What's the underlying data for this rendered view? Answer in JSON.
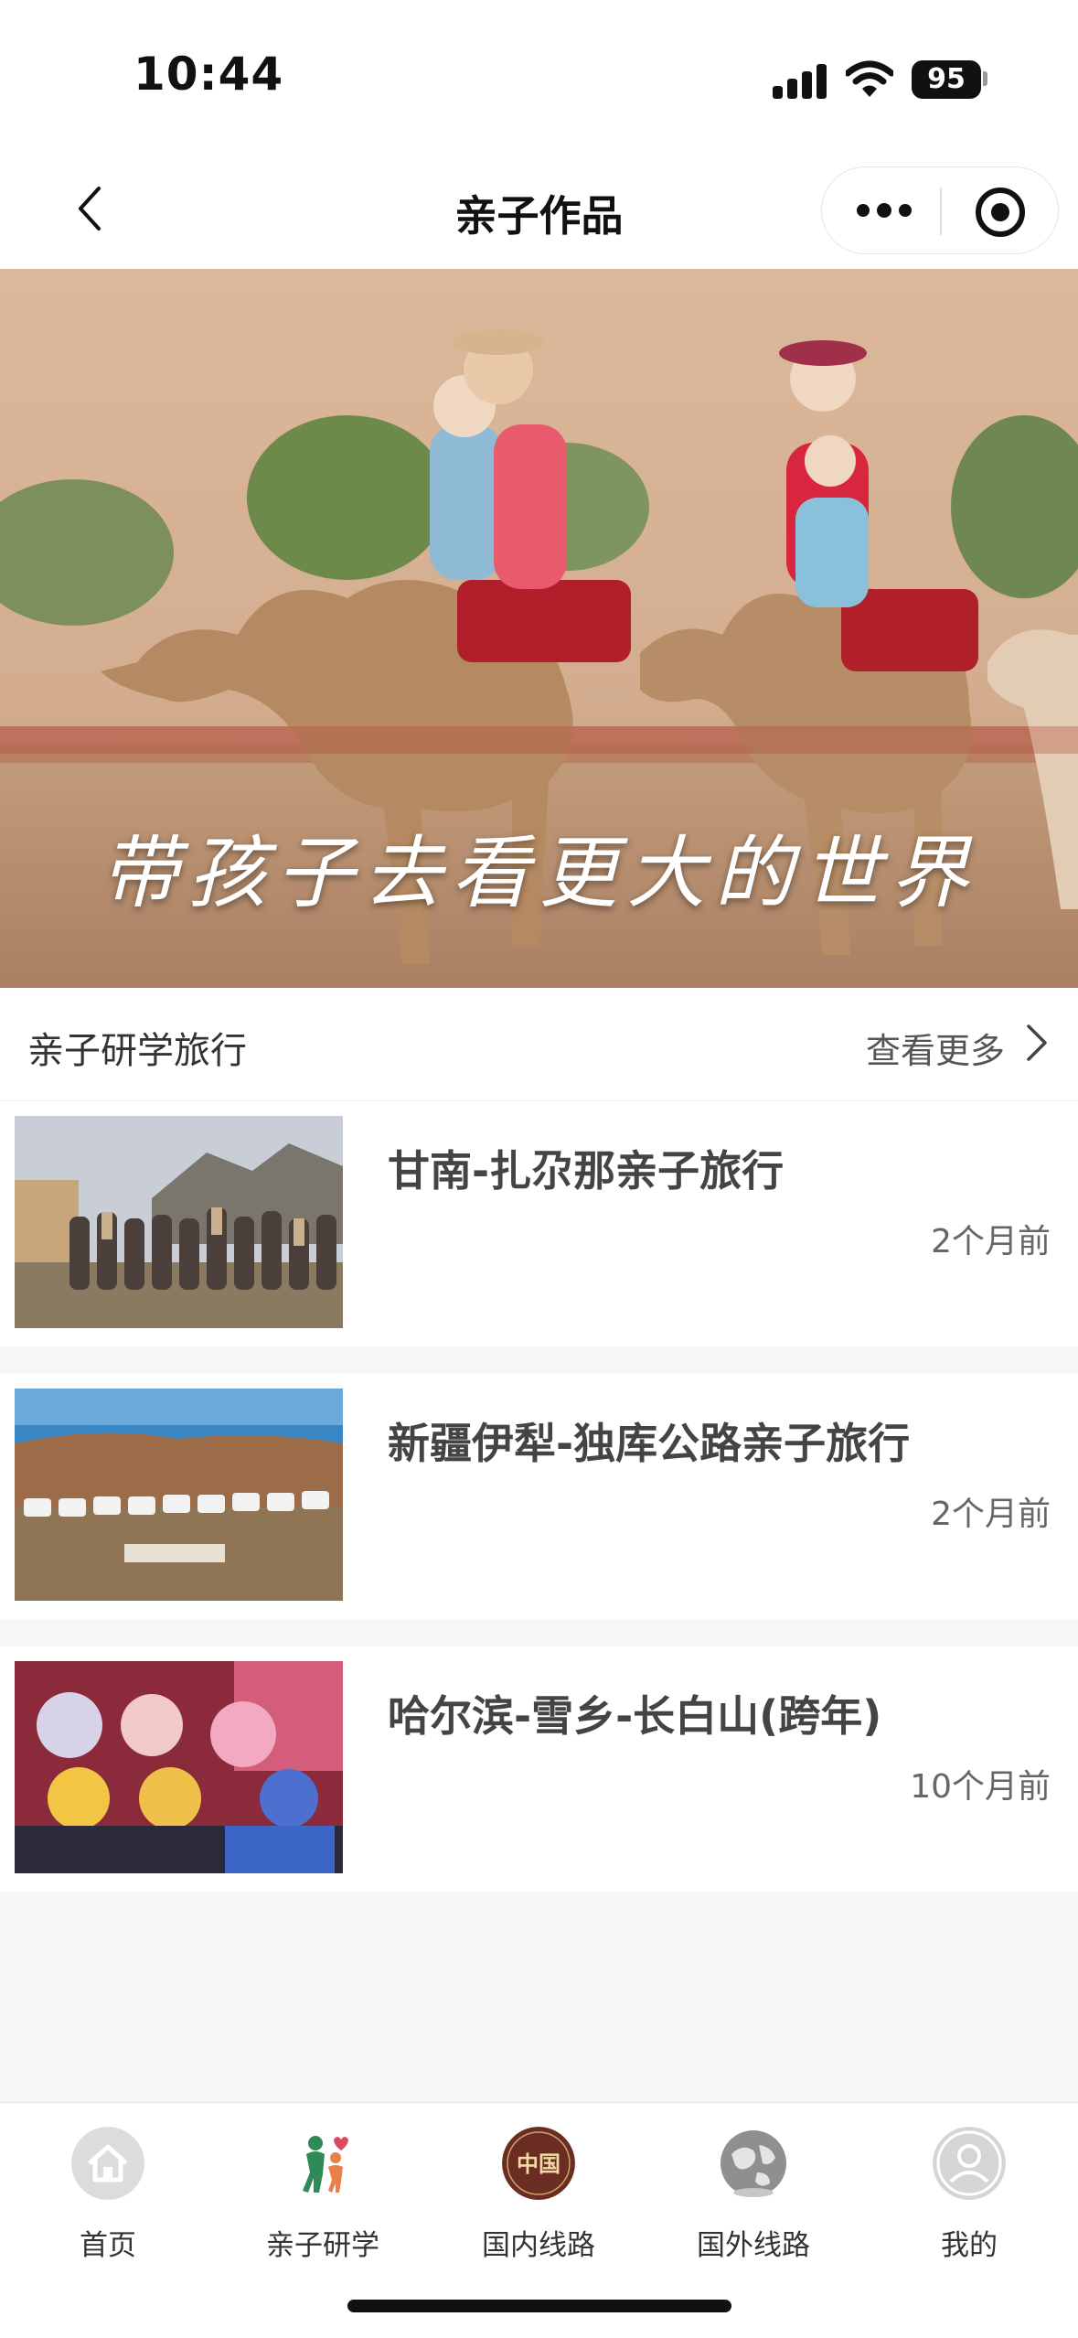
{
  "status_bar": {
    "time": "10:44",
    "battery": "95"
  },
  "nav": {
    "title": "亲子作品"
  },
  "hero": {
    "caption": "带孩子去看更大的世界"
  },
  "section": {
    "title": "亲子研学旅行",
    "see_more": "查看更多"
  },
  "items": [
    {
      "title": "甘南-扎尕那亲子旅行",
      "time": "2个月前"
    },
    {
      "title": "新疆伊犁-独库公路亲子旅行",
      "time": "2个月前"
    },
    {
      "title": "哈尔滨-雪乡-长白山(跨年)",
      "time": "10个月前"
    }
  ],
  "tabbar": {
    "items": [
      {
        "label": "首页",
        "icon": "home-icon"
      },
      {
        "label": "亲子研学",
        "icon": "family-icon"
      },
      {
        "label": "国内线路",
        "icon": "china-badge-icon",
        "badge": "中国"
      },
      {
        "label": "国外线路",
        "icon": "globe-icon"
      },
      {
        "label": "我的",
        "icon": "user-icon"
      }
    ]
  },
  "colors": {
    "accent_brown": "#6b2d22",
    "tab_active": "#2e8b57",
    "background": "#f6f6f6"
  }
}
